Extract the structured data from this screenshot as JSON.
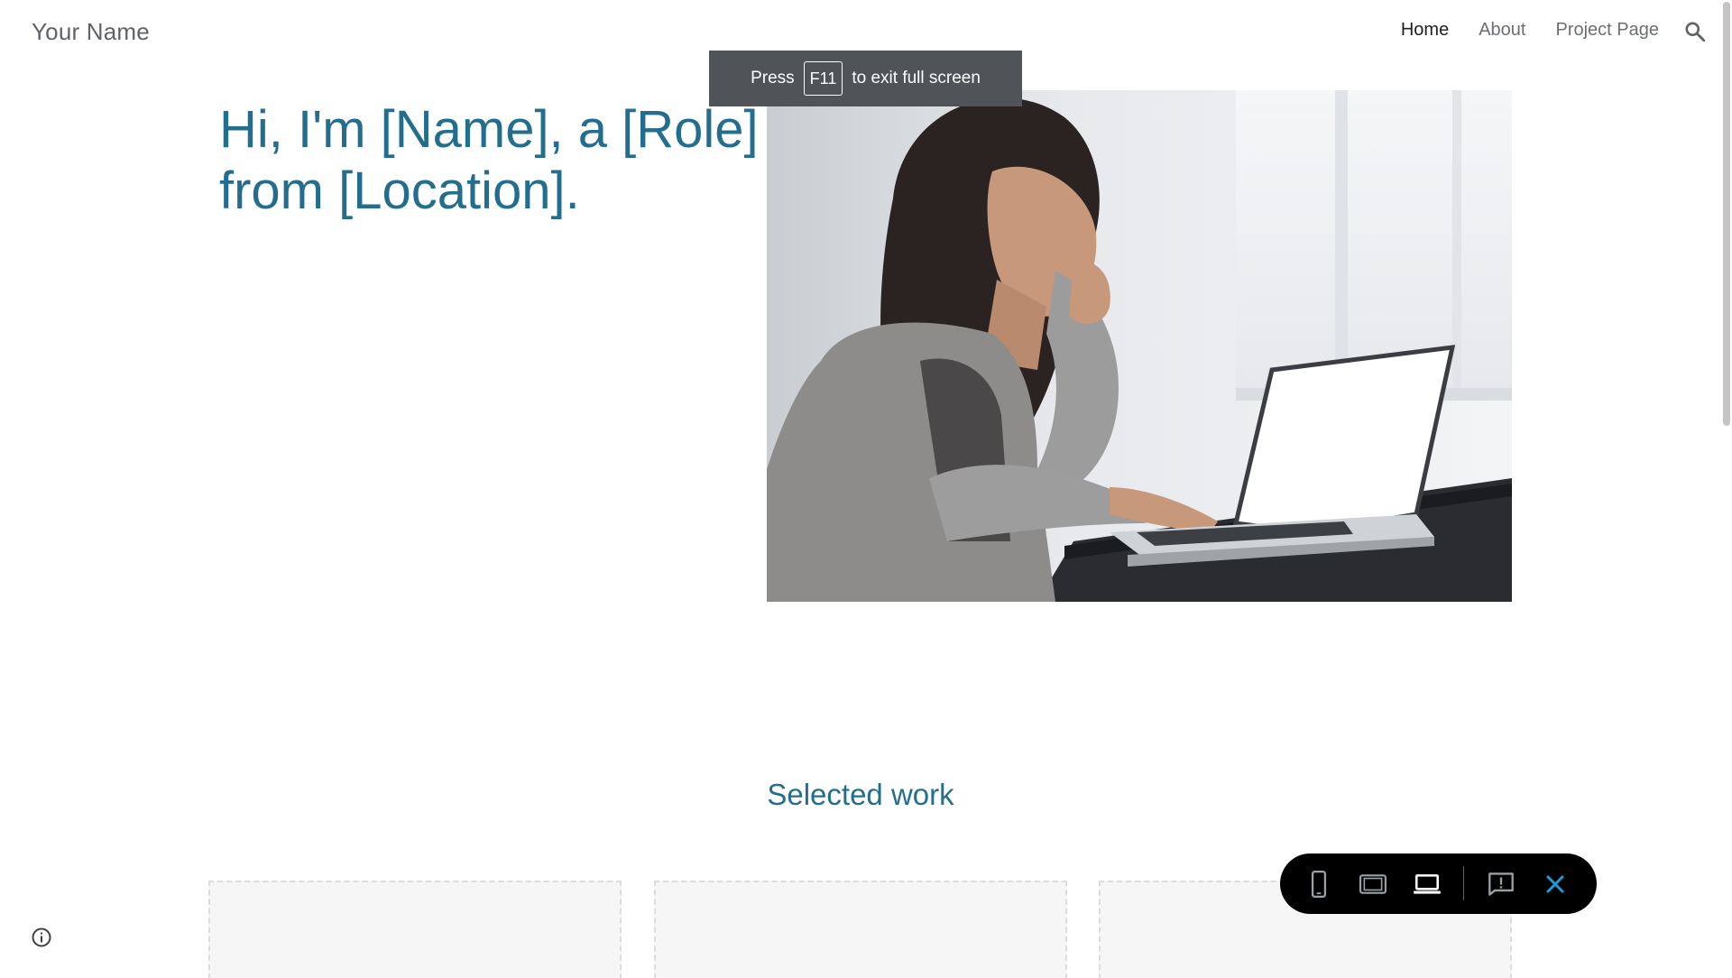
{
  "header": {
    "site_title": "Your Name",
    "nav": [
      {
        "label": "Home",
        "active": true
      },
      {
        "label": "About",
        "active": false
      },
      {
        "label": "Project Page",
        "active": false
      }
    ],
    "search_icon": "search-icon"
  },
  "fullscreen_toast": {
    "before": "Press",
    "key": "F11",
    "after": "to exit full screen"
  },
  "hero": {
    "heading_line1": "Hi, I'm [Name], a [Role]",
    "heading_line2": "from [Location].",
    "image": "woman typing on laptop photo"
  },
  "selected_work": {
    "heading": "Selected work",
    "cards": 3
  },
  "preview_toolbar": {
    "buttons": [
      "phone-preview-icon",
      "tablet-preview-icon",
      "laptop-preview-icon",
      "report-icon",
      "close-icon"
    ],
    "selected": "laptop-preview-icon"
  },
  "colors": {
    "heading": "#236e8e",
    "nav_active": "#212121",
    "nav_inactive": "#6b6f73",
    "toast_bg": "#505357",
    "toolbar_bg": "#000000",
    "close_accent": "#1e9ad6"
  }
}
